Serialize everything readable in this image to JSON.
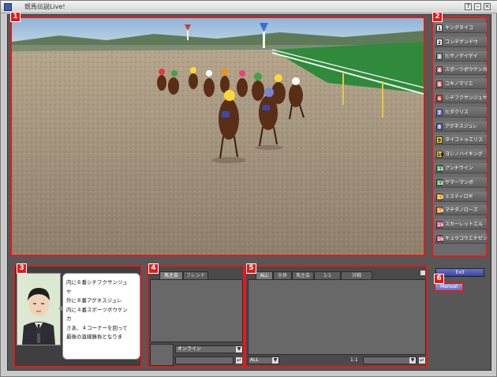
{
  "window": {
    "title": "競馬伝説Live!",
    "controls": [
      "?",
      "–",
      "×"
    ]
  },
  "badges": [
    "1",
    "2",
    "3",
    "4",
    "5",
    "6"
  ],
  "horses": [
    {
      "num": "1",
      "name": "キングタイコ",
      "bg": "#ffffff",
      "fg": "#000000"
    },
    {
      "num": "2",
      "name": "コンチゲンドウ",
      "bg": "#ffffff",
      "fg": "#000000"
    },
    {
      "num": "3",
      "name": "ヒサノゲイゲイ",
      "bg": "#9e9e9e",
      "fg": "#ffffff"
    },
    {
      "num": "4",
      "name": "スポーツボウケンカ",
      "bg": "#e57373",
      "fg": "#ffffff"
    },
    {
      "num": "5",
      "name": "ユキノマリエ",
      "bg": "#e57373",
      "fg": "#ffffff"
    },
    {
      "num": "6",
      "name": "シチフクサンジュヤ",
      "bg": "#e53935",
      "fg": "#ffffff"
    },
    {
      "num": "7",
      "name": "ヒダクリス",
      "bg": "#7986cb",
      "fg": "#ffffff"
    },
    {
      "num": "8",
      "name": "アグネスジュレ",
      "bg": "#5c6bc0",
      "fg": "#ffffff"
    },
    {
      "num": "9",
      "name": "タイコトゥエリス",
      "bg": "#fdd835",
      "fg": "#000000"
    },
    {
      "num": "10",
      "name": "ヨシノハイキング",
      "bg": "#fdd835",
      "fg": "#000000"
    },
    {
      "num": "11",
      "name": "アンチライン",
      "bg": "#43a047",
      "fg": "#ffffff"
    },
    {
      "num": "12",
      "name": "サマーマンボ",
      "bg": "#43a047",
      "fg": "#ffffff"
    },
    {
      "num": "13",
      "name": "ミスティロギ",
      "bg": "#fb8c00",
      "fg": "#ffffff"
    },
    {
      "num": "14",
      "name": "マチダノローズ",
      "bg": "#fb8c00",
      "fg": "#ffffff"
    },
    {
      "num": "15",
      "name": "スカーレットエル",
      "bg": "#ec407a",
      "fg": "#ffffff"
    },
    {
      "num": "16",
      "name": "キュウコウエチゼン",
      "bg": "#ec407a",
      "fg": "#ffffff"
    }
  ],
  "commentary": {
    "lines": [
      "内に６番シチフクサンジュ",
      "ヤ",
      "外に８番アグネスジュレ",
      "内に４番スポーツボウケン",
      "カ",
      "さあ、４コーナーを回って",
      "最後の直線勝負となりま"
    ]
  },
  "friends_panel": {
    "tabs": [
      "馬主会",
      "フレンド"
    ],
    "status_value": "オンライン"
  },
  "chat_panel": {
    "tabs": [
      "ALL",
      "全体",
      "馬主会",
      "1:1",
      "対戦"
    ],
    "channel_value": "ALL",
    "target_label": "1:1"
  },
  "buttons": {
    "exit": "Exit",
    "manual": "Manual"
  },
  "colors": {
    "highlight": "#e21a1a",
    "panel_bg": "#4a4a4a"
  }
}
